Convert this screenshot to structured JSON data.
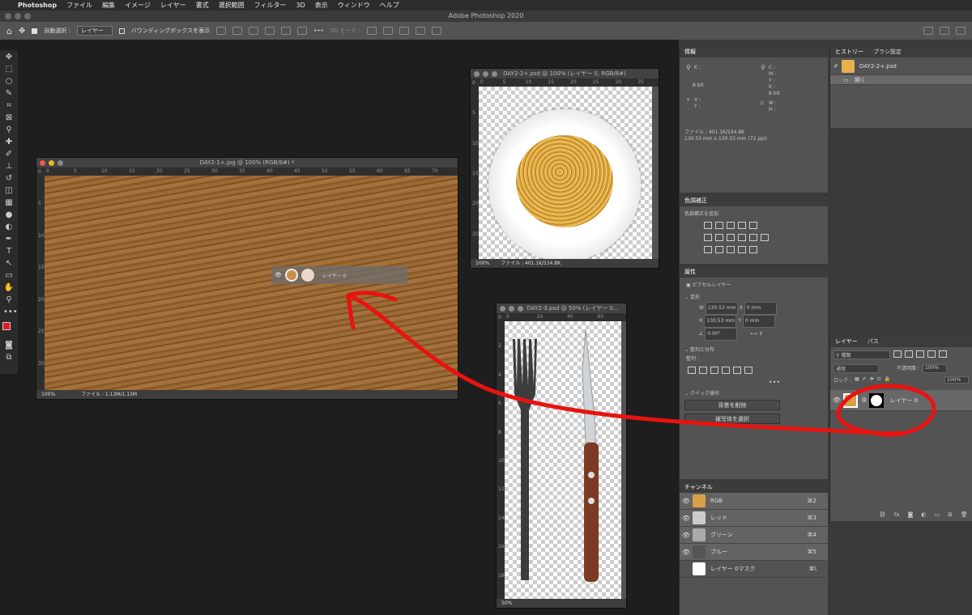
{
  "menubar": {
    "apple": "",
    "app": "Photoshop",
    "items": [
      "ファイル",
      "編集",
      "イメージ",
      "レイヤー",
      "書式",
      "選択範囲",
      "フィルター",
      "3D",
      "表示",
      "ウィンドウ",
      "ヘルプ"
    ]
  },
  "title": "Adobe Photoshop 2020",
  "options": {
    "auto_select": "自動選択 :",
    "layer_dropdown": "レイヤー",
    "bounding_box": "バウンディングボックスを表示",
    "mode3d": "3D モード :"
  },
  "win1": {
    "title": "DAY2-1+.jpg @ 100% (RGB/8#) *",
    "zoom": "100%",
    "file": "ファイル : 1.13M/1.13M",
    "ruler": [
      "0",
      "5",
      "10",
      "15",
      "20",
      "25",
      "30",
      "35",
      "40",
      "45",
      "50",
      "55",
      "60",
      "65",
      "70"
    ],
    "vruler": [
      "0",
      "5",
      "10",
      "15",
      "20",
      "25",
      "30"
    ],
    "drag_layer": "レイヤー 0"
  },
  "win2": {
    "title": "DAY2-2+.psd @ 100% (レイヤー 0, RGB/8#)",
    "zoom": "100%",
    "file": "ファイル : 401.1K/534.8K",
    "ruler": [
      "0",
      "5",
      "10",
      "15",
      "20",
      "25",
      "30",
      "35"
    ],
    "vruler": [
      "0",
      "5",
      "10",
      "15",
      "20",
      "25"
    ]
  },
  "win3": {
    "title": "DAY2-3.psd @ 50% (レイヤー 0...",
    "zoom": "50%",
    "ruler": [
      "0",
      "20",
      "40",
      "60"
    ],
    "vruler": [
      "0",
      "2",
      "4",
      "6",
      "8",
      "10",
      "12",
      "14",
      "16",
      "18"
    ]
  },
  "info": {
    "tab": "情報",
    "k": "K :",
    "cmyk": [
      "C :",
      "M :",
      "Y :",
      "K :"
    ],
    "bit1": "8 bit",
    "bit2": "8 bit",
    "x": "X :",
    "y": "Y :",
    "w": "W :",
    "h": "H :",
    "file": "ファイル : 401.1K/534.8K",
    "size": "130.53 mm x 130.53 mm (72 ppi)"
  },
  "history": {
    "tabs": [
      "ヒストリー",
      "ブラシ設定"
    ],
    "doc": "DAY2-2+.psd",
    "step": "開く"
  },
  "adjust": {
    "tab": "色調補正",
    "add": "色調補正を追加"
  },
  "props": {
    "tab": "属性",
    "kind": "ピクセルレイヤー",
    "transform": "変形",
    "w": "W",
    "h": "H",
    "wval": "130.53 mm",
    "hval": "130.53 mm",
    "x": "X",
    "y": "Y",
    "xval": "0 mm",
    "yval": "0 mm",
    "angle": "0.00°",
    "align": "整列と分布",
    "align_sub": "整列 :",
    "quick": "クイック操作",
    "btn1": "背景を削除",
    "btn2": "被写体を選択"
  },
  "layers": {
    "tabs": [
      "レイヤー",
      "パス"
    ],
    "kind": "種類",
    "mode": "通常",
    "opacity_label": "不透明度 :",
    "opacity": "100%",
    "lock": "ロック :",
    "fill": "100%",
    "layer": "レイヤー 0"
  },
  "channels": {
    "tab": "チャンネル",
    "rows": [
      {
        "name": "RGB",
        "key": "⌘2"
      },
      {
        "name": "レッド",
        "key": "⌘3"
      },
      {
        "name": "グリーン",
        "key": "⌘4"
      },
      {
        "name": "ブルー",
        "key": "⌘5"
      },
      {
        "name": "レイヤー 0マスク",
        "key": "⌘\\"
      }
    ]
  },
  "colors": {
    "fg": "#e21b1b",
    "bg": "#000000",
    "annotation": "#e8130f"
  }
}
